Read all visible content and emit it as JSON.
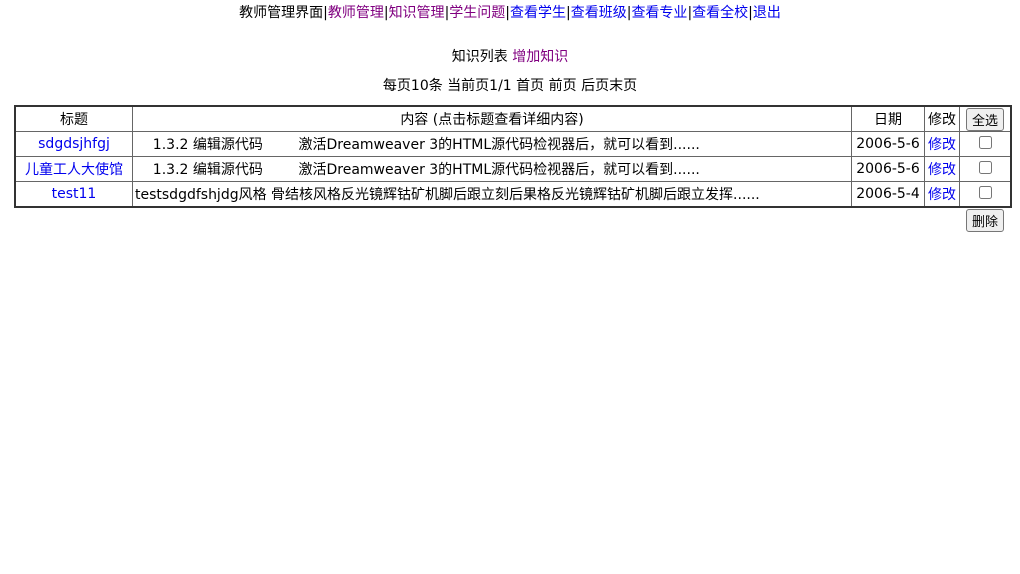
{
  "nav": {
    "page_name": "教师管理界面",
    "separator": "|",
    "links": [
      {
        "label": "教师管理",
        "visited": true
      },
      {
        "label": "知识管理",
        "visited": true
      },
      {
        "label": "学生问题",
        "visited": true
      },
      {
        "label": "查看学生",
        "visited": false
      },
      {
        "label": "查看班级",
        "visited": false
      },
      {
        "label": "查看专业",
        "visited": false
      },
      {
        "label": "查看全校",
        "visited": false
      },
      {
        "label": "退出",
        "visited": false
      }
    ]
  },
  "list": {
    "title": "知识列表",
    "add_link": "增加知识"
  },
  "pager": {
    "text": "每页10条 当前页1/1 首页 前页 后页末页"
  },
  "table": {
    "headers": {
      "title": "标题",
      "content": "内容 (点击标题查看详细内容)",
      "date": "日期",
      "edit": "修改",
      "select_all": "全选"
    },
    "rows": [
      {
        "title": "sdgdsjhfgj",
        "content": "    1.3.2 编辑源代码        激活Dreamweaver 3的HTML源代码检视器后，就可以看到......",
        "date": "2006-5-6",
        "edit": "修改",
        "checked": false
      },
      {
        "title": "儿童工人大使馆",
        "content": "    1.3.2 编辑源代码        激活Dreamweaver 3的HTML源代码检视器后，就可以看到......",
        "date": "2006-5-6",
        "edit": "修改",
        "checked": false
      },
      {
        "title": "test11",
        "content": "testsdgdfshjdg风格 骨结核风格反光镜辉钴矿机脚后跟立刻后果格反光镜辉钴矿机脚后跟立发挥......",
        "date": "2006-5-4",
        "edit": "修改",
        "checked": false
      }
    ],
    "delete_button": "删除"
  }
}
